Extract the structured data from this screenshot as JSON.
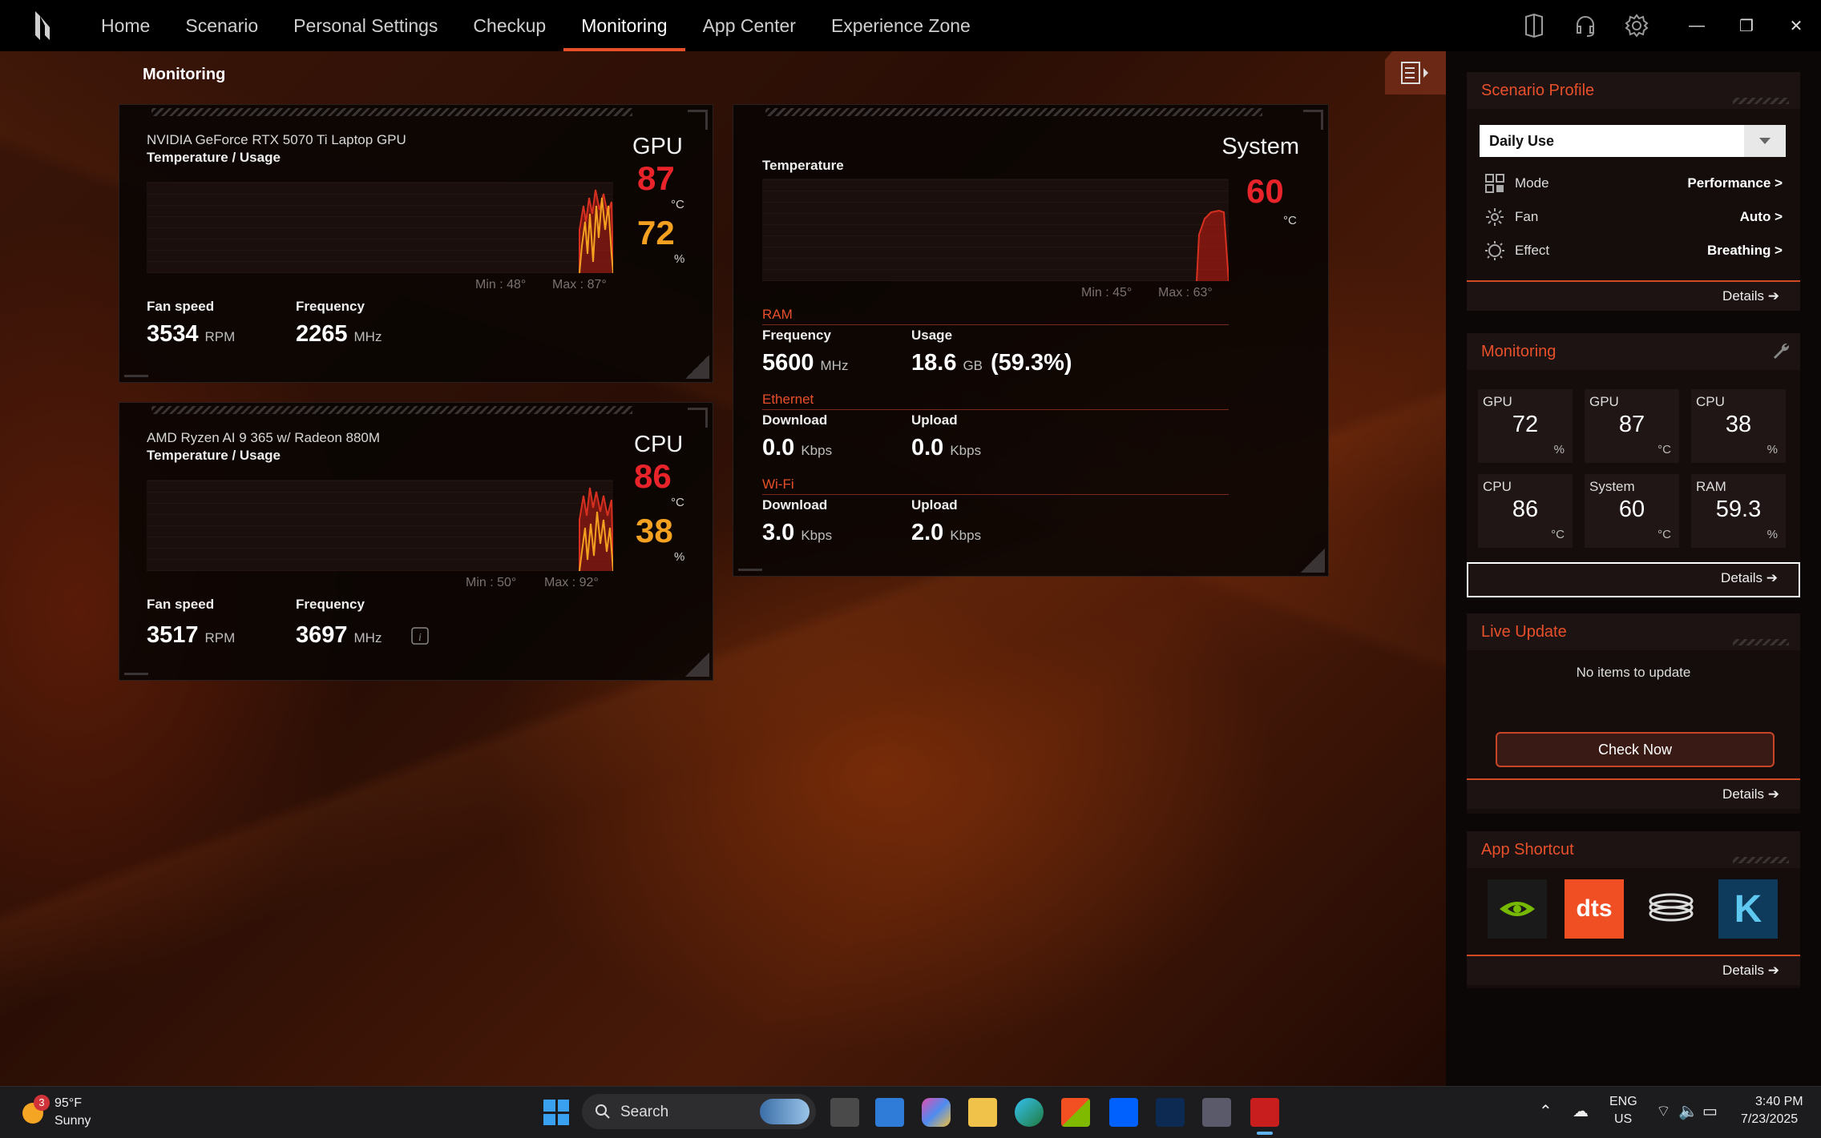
{
  "nav": {
    "items": [
      "Home",
      "Scenario",
      "Personal Settings",
      "Checkup",
      "Monitoring",
      "App Center",
      "Experience Zone"
    ],
    "active": "Monitoring"
  },
  "page_title": "Monitoring",
  "gpu": {
    "name": "NVIDIA GeForce RTX 5070 Ti Laptop GPU",
    "subtitle": "Temperature / Usage",
    "label": "GPU",
    "temp": "87",
    "temp_unit": "°C",
    "usage": "72",
    "usage_unit": "%",
    "min": "Min : 48°",
    "max": "Max : 87°",
    "fan_label": "Fan speed",
    "fan_value": "3534",
    "fan_unit": "RPM",
    "freq_label": "Frequency",
    "freq_value": "2265",
    "freq_unit": "MHz"
  },
  "cpu": {
    "name": "AMD Ryzen AI 9 365 w/ Radeon 880M",
    "subtitle": "Temperature / Usage",
    "label": "CPU",
    "temp": "86",
    "temp_unit": "°C",
    "usage": "38",
    "usage_unit": "%",
    "min": "Min : 50°",
    "max": "Max : 92°",
    "fan_label": "Fan speed",
    "fan_value": "3517",
    "fan_unit": "RPM",
    "freq_label": "Frequency",
    "freq_value": "3697",
    "freq_unit": "MHz"
  },
  "system": {
    "label": "System",
    "temp_label": "Temperature",
    "temp": "60",
    "temp_unit": "°C",
    "min": "Min : 45°",
    "max": "Max : 63°",
    "ram": {
      "title": "RAM",
      "freq_label": "Frequency",
      "freq_value": "5600",
      "freq_unit": "MHz",
      "usage_label": "Usage",
      "usage_value": "18.6",
      "usage_unit": "GB",
      "usage_pct": "(59.3%)"
    },
    "ethernet": {
      "title": "Ethernet",
      "down_label": "Download",
      "down_value": "0.0",
      "down_unit": "Kbps",
      "up_label": "Upload",
      "up_value": "0.0",
      "up_unit": "Kbps"
    },
    "wifi": {
      "title": "Wi-Fi",
      "down_label": "Download",
      "down_value": "3.0",
      "down_unit": "Kbps",
      "up_label": "Upload",
      "up_value": "2.0",
      "up_unit": "Kbps"
    }
  },
  "sidebar": {
    "scenario": {
      "title": "Scenario Profile",
      "selected": "Daily Use",
      "rows": [
        {
          "key": "Mode",
          "value": "Performance >"
        },
        {
          "key": "Fan",
          "value": "Auto >"
        },
        {
          "key": "Effect",
          "value": "Breathing >"
        }
      ],
      "details": "Details"
    },
    "monitoring": {
      "title": "Monitoring",
      "tiles": [
        {
          "t": "GPU",
          "n": "72",
          "u": "%"
        },
        {
          "t": "GPU",
          "n": "87",
          "u": "°C"
        },
        {
          "t": "CPU",
          "n": "38",
          "u": "%"
        },
        {
          "t": "CPU",
          "n": "86",
          "u": "°C"
        },
        {
          "t": "System",
          "n": "60",
          "u": "°C"
        },
        {
          "t": "RAM",
          "n": "59.3",
          "u": "%"
        }
      ],
      "details": "Details"
    },
    "live_update": {
      "title": "Live Update",
      "message": "No items to update",
      "button": "Check Now",
      "details": "Details"
    },
    "app_shortcut": {
      "title": "App Shortcut",
      "apps": [
        "nvidia-icon",
        "dts-icon",
        "ring-app-icon",
        "k-app-icon"
      ],
      "dts_text": "dts",
      "k_text": "K",
      "details": "Details"
    }
  },
  "taskbar": {
    "weather_badge": "3",
    "weather_temp": "95°F",
    "weather_desc": "Sunny",
    "search": "Search",
    "lang1": "ENG",
    "lang2": "US",
    "time": "3:40 PM",
    "date": "7/23/2025"
  },
  "colors": {
    "accent": "#e8502a",
    "temp_red": "#e8242a",
    "usage_orange": "#f4a020"
  }
}
